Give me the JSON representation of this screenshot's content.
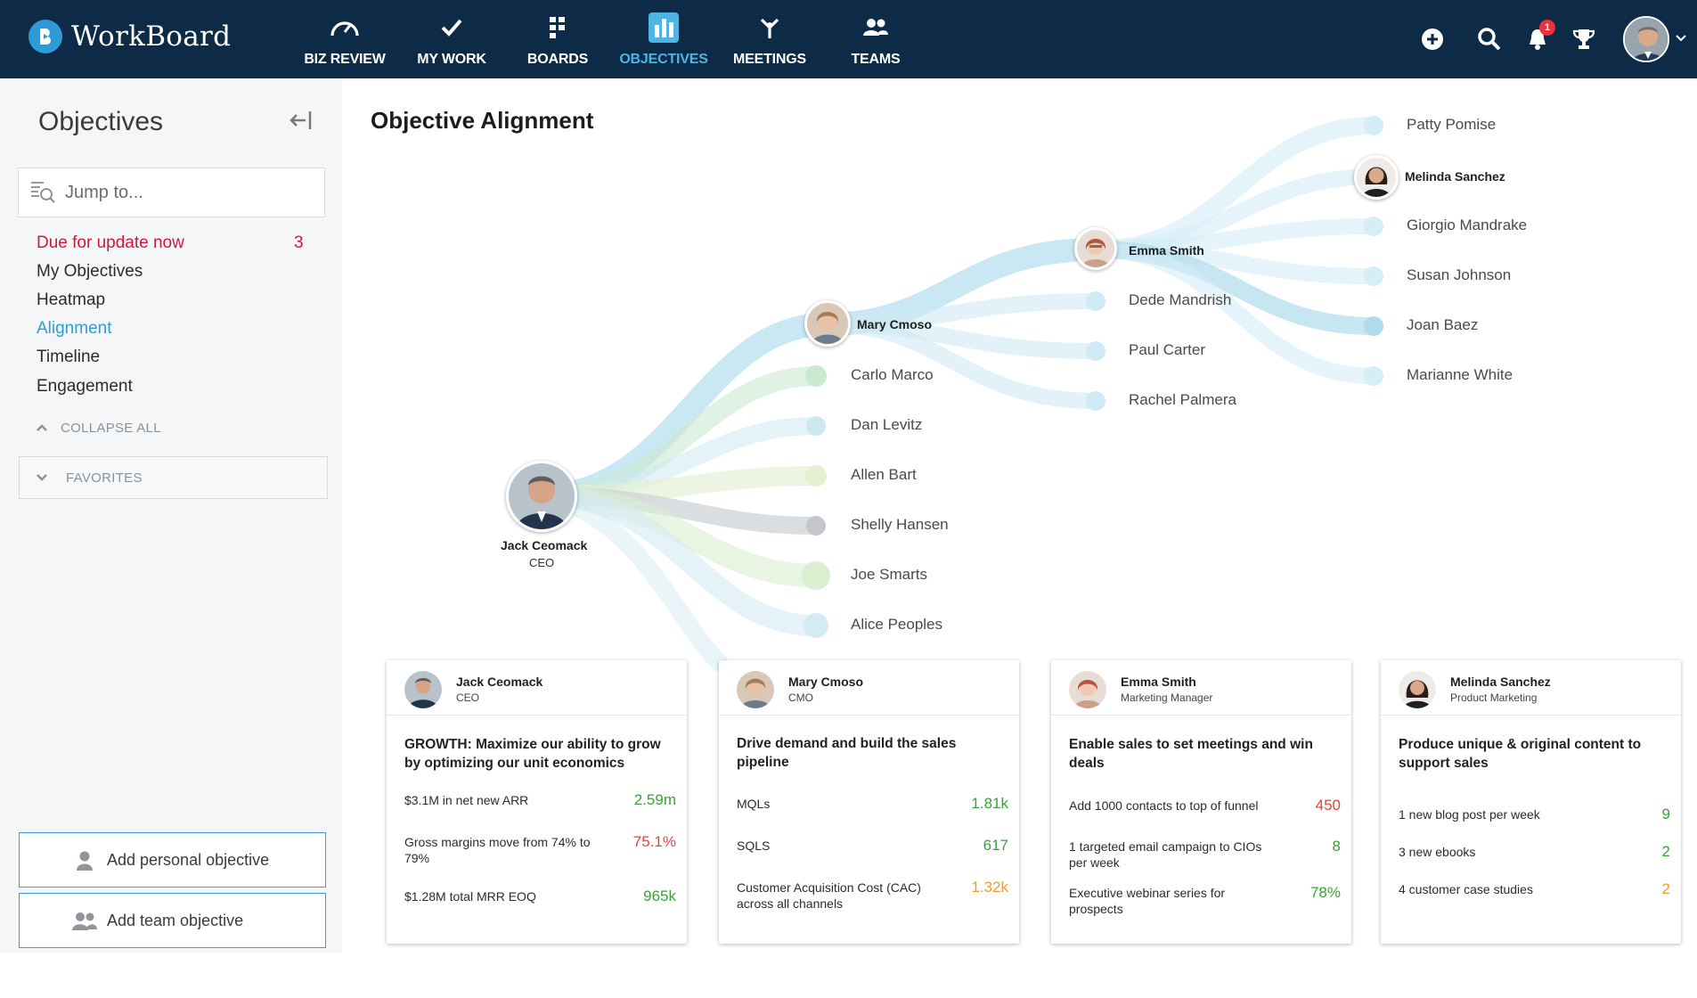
{
  "app": {
    "brand": "WorkBoard"
  },
  "nav": {
    "items": [
      {
        "id": "biz-review",
        "label": "BIZ REVIEW",
        "icon": "gauge-icon"
      },
      {
        "id": "my-work",
        "label": "MY WORK",
        "icon": "checkmark-icon"
      },
      {
        "id": "boards",
        "label": "BOARDS",
        "icon": "boards-icon"
      },
      {
        "id": "objectives",
        "label": "OBJECTIVES",
        "icon": "bar-chart-icon",
        "active": true
      },
      {
        "id": "meetings",
        "label": "MEETINGS",
        "icon": "meetings-icon"
      },
      {
        "id": "teams",
        "label": "TEAMS",
        "icon": "people-icon"
      }
    ],
    "notification_count": "1"
  },
  "sidebar": {
    "title": "Objectives",
    "search_placeholder": "Jump to...",
    "links": [
      {
        "label": "Due for update now",
        "count": "3",
        "style": "alert"
      },
      {
        "label": "My Objectives"
      },
      {
        "label": "Heatmap"
      },
      {
        "label": "Alignment",
        "style": "active"
      },
      {
        "label": "Timeline"
      },
      {
        "label": "Engagement"
      }
    ],
    "collapse_all": "COLLAPSE ALL",
    "favorites": "FAVORITES",
    "add_personal": "Add personal objective",
    "add_team": "Add team objective"
  },
  "main": {
    "title": "Objective Alignment",
    "tree": {
      "root": {
        "name": "Jack Ceomack",
        "role": "CEO"
      },
      "level1": [
        {
          "name": "Mary Cmoso",
          "has_avatar": true
        },
        {
          "name": "Carlo Marco"
        },
        {
          "name": "Dan Levitz"
        },
        {
          "name": "Allen Bart"
        },
        {
          "name": "Shelly Hansen"
        },
        {
          "name": "Joe Smarts"
        },
        {
          "name": "Alice Peoples"
        }
      ],
      "level2": [
        {
          "name": "Emma Smith",
          "has_avatar": true
        },
        {
          "name": "Dede Mandrish"
        },
        {
          "name": "Paul Carter"
        },
        {
          "name": "Rachel Palmera"
        }
      ],
      "level3": [
        {
          "name": "Patty Pomise"
        },
        {
          "name": "Melinda Sanchez",
          "has_avatar": true
        },
        {
          "name": "Giorgio Mandrake"
        },
        {
          "name": "Susan Johnson"
        },
        {
          "name": "Joan Baez"
        },
        {
          "name": "Marianne White"
        }
      ]
    },
    "cards": [
      {
        "name": "Jack Ceomack",
        "role": "CEO",
        "objective": "GROWTH: Maximize our ability to grow by optimizing our unit economics",
        "results": [
          {
            "text": "$3.1M in net new ARR",
            "value": "2.59m",
            "status": "green"
          },
          {
            "text": "Gross margins move from 74% to 79%",
            "value": "75.1%",
            "status": "red"
          },
          {
            "text": "$1.28M total MRR EOQ",
            "value": "965k",
            "status": "green"
          }
        ]
      },
      {
        "name": "Mary Cmoso",
        "role": "CMO",
        "objective": "Drive demand and build the sales pipeline",
        "results": [
          {
            "text": "MQLs",
            "value": "1.81k",
            "status": "green"
          },
          {
            "text": "SQLS",
            "value": "617",
            "status": "green"
          },
          {
            "text": "Customer Acquisition Cost (CAC) across all channels",
            "value": "1.32k",
            "status": "orange"
          }
        ]
      },
      {
        "name": "Emma Smith",
        "role": "Marketing Manager",
        "objective": "Enable sales to set meetings and win deals",
        "results": [
          {
            "text": "Add 1000 contacts to top of funnel",
            "value": "450",
            "status": "red"
          },
          {
            "text": "1 targeted email campaign to CIOs per week",
            "value": "8",
            "status": "green"
          },
          {
            "text": "Executive webinar series for prospects",
            "value": "78%",
            "status": "green"
          }
        ]
      },
      {
        "name": "Melinda Sanchez",
        "role": "Product Marketing",
        "objective": "Produce unique & original content to support sales",
        "results": [
          {
            "text": "1 new blog post per week",
            "value": "9",
            "status": "green"
          },
          {
            "text": "3 new ebooks",
            "value": "2",
            "status": "green"
          },
          {
            "text": "4 customer case studies",
            "value": "2",
            "status": "orange"
          }
        ]
      }
    ]
  },
  "colors": {
    "nav_bg": "#0d2a47",
    "accent": "#2b9ed8",
    "alert": "#d0183a",
    "good": "#3aa23a",
    "bad": "#e2453b",
    "warn": "#f19b2c"
  }
}
